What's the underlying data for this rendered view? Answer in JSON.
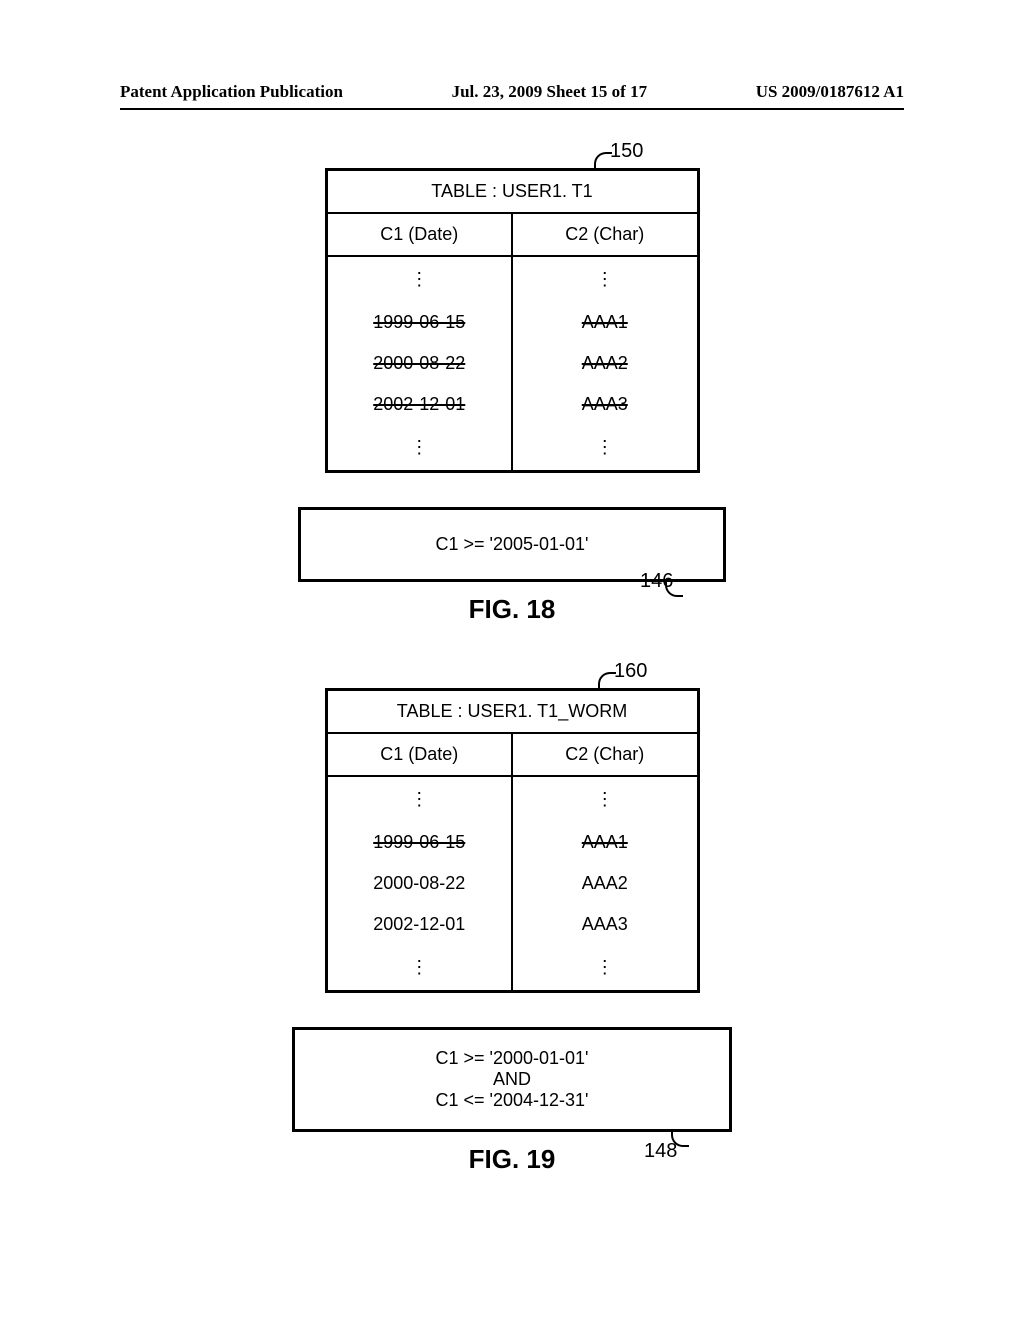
{
  "header": {
    "left": "Patent Application Publication",
    "center": "Jul. 23, 2009  Sheet 15 of 17",
    "right": "US 2009/0187612 A1"
  },
  "fig18": {
    "ref_table": "150",
    "table_title": "TABLE : USER1. T1",
    "col1": "C1 (Date)",
    "col2": "C2 (Char)",
    "rows": [
      {
        "c1": "1999-06-15",
        "c2": "AAA1",
        "strike": true
      },
      {
        "c1": "2000-08-22",
        "c2": "AAA2",
        "strike": true
      },
      {
        "c1": "2002-12-01",
        "c2": "AAA3",
        "strike": true
      }
    ],
    "condition": "C1 >= '2005-01-01'",
    "ref_cond": "146",
    "caption": "FIG. 18"
  },
  "fig19": {
    "ref_table": "160",
    "table_title": "TABLE : USER1. T1_WORM",
    "col1": "C1 (Date)",
    "col2": "C2 (Char)",
    "rows": [
      {
        "c1": "1999-06-15",
        "c2": "AAA1",
        "strike": true
      },
      {
        "c1": "2000-08-22",
        "c2": "AAA2",
        "strike": false
      },
      {
        "c1": "2002-12-01",
        "c2": "AAA3",
        "strike": false
      }
    ],
    "condition_line1": "C1 >= '2000-01-01'",
    "condition_line2": "AND",
    "condition_line3": "C1 <= '2004-12-31'",
    "ref_cond": "148",
    "caption": "FIG. 19"
  }
}
